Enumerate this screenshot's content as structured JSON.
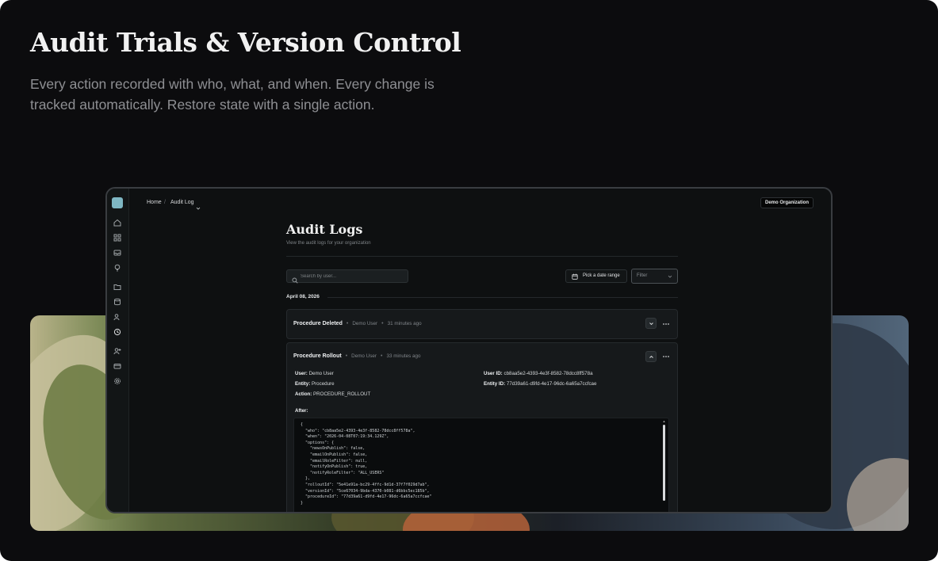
{
  "hero": {
    "title": "Audit Trials & Version Control",
    "subtitle": "Every action recorded with who, what, and when. Every change is tracked automatically. Restore state with a single action."
  },
  "colors": {
    "background": "#0c0c0e",
    "window": "#0e1011",
    "card": "#16191b",
    "accent_logo": "#7fb7c3"
  },
  "sidebar": {
    "icons": [
      "home-icon",
      "grid-icon",
      "inbox-icon",
      "lightbulb-icon",
      "folder-icon",
      "database-icon",
      "users-icon",
      "history-icon",
      "user-plus-icon",
      "card-icon",
      "settings-icon"
    ]
  },
  "topbar": {
    "breadcrumb_home": "Home",
    "breadcrumb_sep": "/",
    "breadcrumb_current": "Audit Log",
    "org_button": "Demo Organization"
  },
  "page": {
    "title": "Audit Logs",
    "subtitle": "View the audit logs for your organization"
  },
  "toolbar": {
    "search_placeholder": "Search by user...",
    "date_range_label": "Pick a date range",
    "filter_placeholder": "Filter"
  },
  "logs": {
    "date_group": "April 08, 2026",
    "entries": [
      {
        "action": "Procedure Deleted",
        "user": "Demo User",
        "time": "31 minutes ago",
        "expanded": false
      },
      {
        "action": "Procedure Rollout",
        "user": "Demo User",
        "time": "33 minutes ago",
        "expanded": true,
        "details": {
          "user_label": "User:",
          "user_value": "Demo User",
          "entity_label": "Entity:",
          "entity_value": "Procedure",
          "action_label": "Action:",
          "action_value": "PROCEDURE_ROLLOUT",
          "user_id_label": "User ID:",
          "user_id_value": "cb8aa5e2-4393-4e3f-8582-78dcc8ff578a",
          "entity_id_label": "Entity ID:",
          "entity_id_value": "77d39a61-d9fd-4e17-96dc-6a65a7ccfcae",
          "after_label": "After:",
          "after_json": "{\n  \"who\": \"cb8aa5e2-4393-4e3f-8582-78dcc8ff578a\",\n  \"when\": \"2026-04-08T07:19:34.129Z\",\n  \"options\": {\n    \"newsOnPublish\": false,\n    \"emailOnPublish\": false,\n    \"emailRoleFilter\": null,\n    \"notifyOnPublish\": true,\n    \"notifyRoleFilter\": \"ALL_USERS\"\n  },\n  \"rolloutId\": \"5e41e91a-bc29-4ffc-9d1d-37f7f029d7ab\",\n  \"versionId\": \"5ce67034-9bda-4370-b081-d6bbc5ec185b\",\n  \"procedureId\": \"77d39a61-d9fd-4e17-96dc-6a65a7ccfcae\"\n}"
        }
      }
    ]
  }
}
